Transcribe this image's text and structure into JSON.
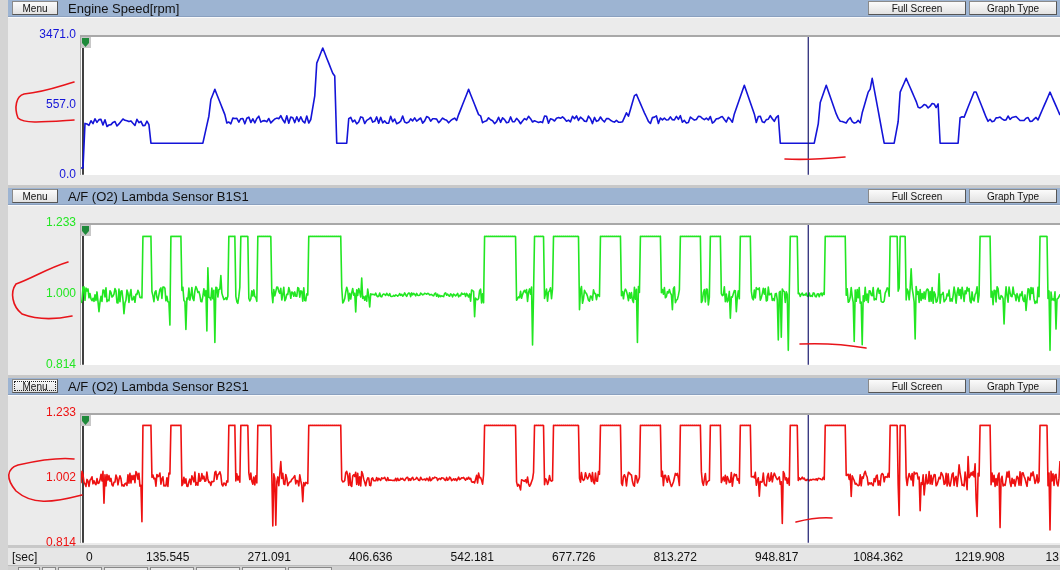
{
  "graphs": [
    {
      "kind": "speed",
      "menu_label": "Menu",
      "focused": false,
      "title": "Engine Speed[rpm]",
      "buttons": [
        "Full Screen",
        "Graph Type"
      ],
      "color": "#1414d8",
      "y_labels": [
        "3471.0",
        "557.0",
        "0.0"
      ]
    },
    {
      "kind": "lambda",
      "menu_label": "Menu",
      "focused": false,
      "title": "A/F (O2) Lambda Sensor B1S1",
      "buttons": [
        "Full Screen",
        "Graph Type"
      ],
      "color": "#22e622",
      "y_labels": [
        "1.233",
        "1.000",
        "0.814"
      ]
    },
    {
      "kind": "lambda",
      "menu_label": "Menu",
      "focused": true,
      "title": "A/F (O2) Lambda Sensor B2S1",
      "buttons": [
        "Full Screen",
        "Graph Type"
      ],
      "color": "#ee1111",
      "y_labels": [
        "1.233",
        "1.002",
        "0.814"
      ]
    }
  ],
  "x_axis": {
    "unit": "[sec]",
    "ticks": [
      "0",
      "135.545",
      "271.091",
      "406.636",
      "542.181",
      "677.726",
      "813.272",
      "948.817",
      "1084.362",
      "1219.908",
      "13"
    ]
  }
}
